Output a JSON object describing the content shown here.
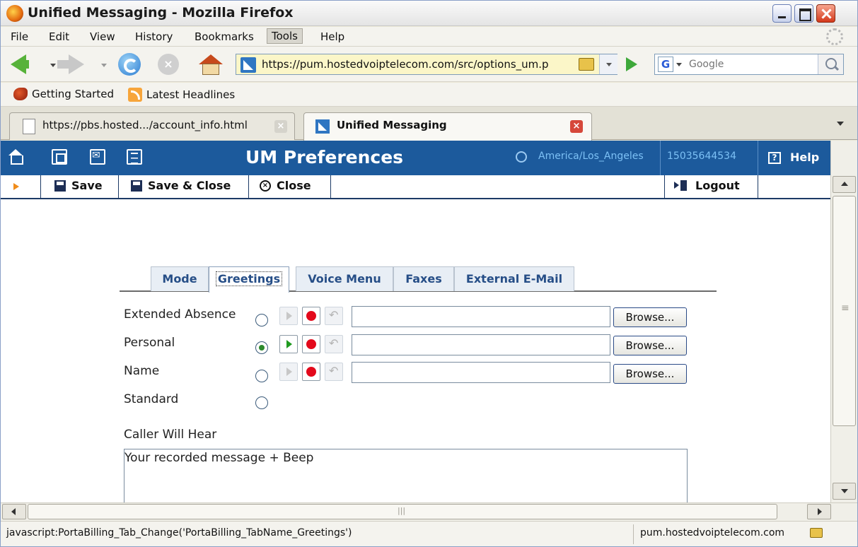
{
  "window": {
    "title": "Unified Messaging - Mozilla Firefox"
  },
  "menu": {
    "items": [
      "File",
      "Edit",
      "View",
      "History",
      "Bookmarks",
      "Tools",
      "Help"
    ]
  },
  "nav": {
    "url": "https://pum.hostedvoiptelecom.com/src/options_um.p",
    "search_placeholder": "Google"
  },
  "bookmarks": {
    "items": [
      "Getting Started",
      "Latest Headlines"
    ]
  },
  "tabs": [
    {
      "label": "https://pbs.hosted.../account_info.html",
      "active": false
    },
    {
      "label": "Unified Messaging",
      "active": true
    }
  ],
  "page": {
    "header": {
      "title": "UM Preferences",
      "timezone": "America/Los_Angeles",
      "phone": "15035644534",
      "help": "Help"
    },
    "toolbar": {
      "save": "Save",
      "save_close": "Save & Close",
      "close": "Close",
      "logout": "Logout"
    },
    "section_tabs": [
      {
        "label": "Mode",
        "active": false
      },
      {
        "label": "Greetings",
        "active": true
      },
      {
        "label": "Voice Menu",
        "active": false
      },
      {
        "label": "Faxes",
        "active": false
      },
      {
        "label": "External E-Mail",
        "active": false
      }
    ],
    "greetings": [
      {
        "label": "Extended Absence",
        "selected": false,
        "playable": false,
        "browse": "Browse..."
      },
      {
        "label": "Personal",
        "selected": true,
        "playable": true,
        "browse": "Browse..."
      },
      {
        "label": "Name",
        "selected": false,
        "playable": false,
        "browse": "Browse..."
      },
      {
        "label": "Standard",
        "selected": false
      }
    ],
    "caller_label": "Caller Will Hear",
    "caller_text": "Your recorded message + Beep"
  },
  "status": {
    "text": "javascript:PortaBilling_Tab_Change('PortaBilling_TabName_Greetings')",
    "host": "pum.hostedvoiptelecom.com"
  },
  "colors": {
    "header_bg": "#1c5a9c",
    "accent_link": "#7cc0f5",
    "record_red": "#e3091b",
    "play_green": "#1f9a1f"
  }
}
